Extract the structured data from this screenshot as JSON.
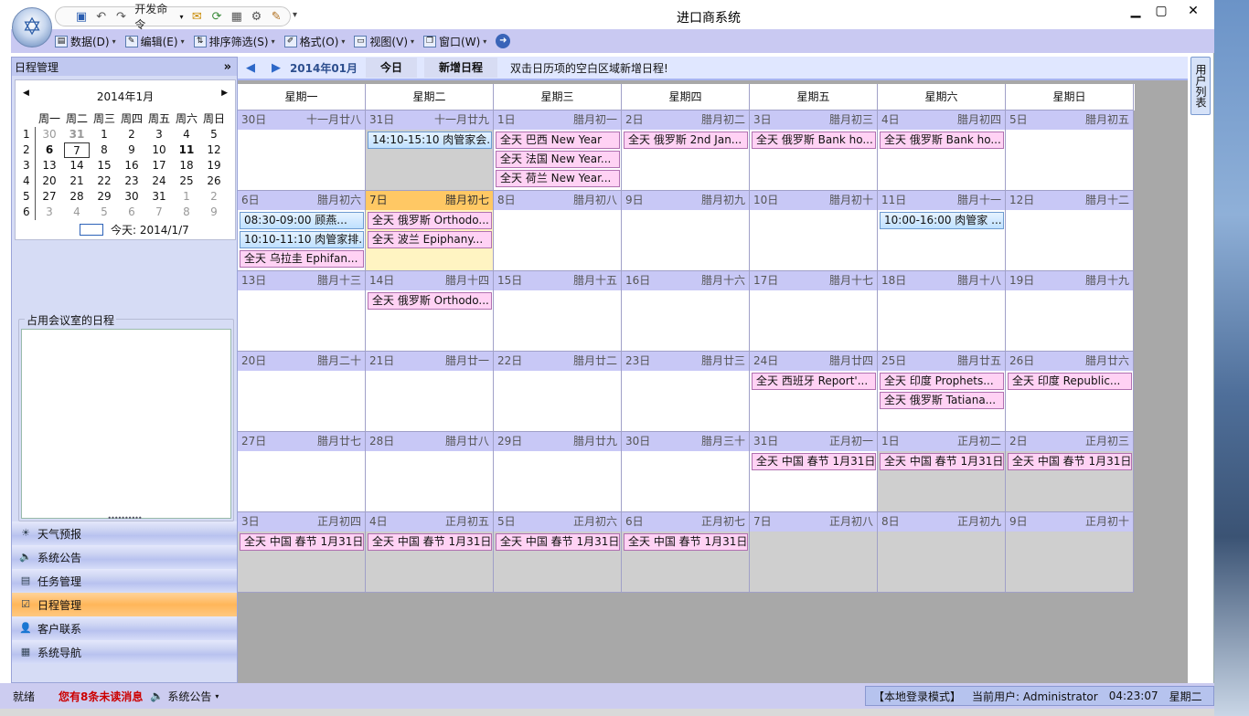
{
  "window": {
    "title": "进口商系统"
  },
  "quick_access": {
    "dev_commands": "开发命令"
  },
  "menu": [
    {
      "label": "数据(D)",
      "icon": "database-icon"
    },
    {
      "label": "编辑(E)",
      "icon": "edit-icon"
    },
    {
      "label": "排序筛选(S)",
      "icon": "sort-filter-icon"
    },
    {
      "label": "格式(O)",
      "icon": "format-brush-icon"
    },
    {
      "label": "视图(V)",
      "icon": "view-icon"
    },
    {
      "label": "窗口(W)",
      "icon": "window-icon"
    }
  ],
  "left_panel": {
    "title": "日程管理",
    "calendar": {
      "title": "2014年1月",
      "weekdays": [
        "周一",
        "周二",
        "周三",
        "周四",
        "周五",
        "周六",
        "周日"
      ],
      "weeks": [
        {
          "wk": "1",
          "days": [
            "30",
            "31",
            "1",
            "2",
            "3",
            "4",
            "5"
          ]
        },
        {
          "wk": "2",
          "days": [
            "6",
            "7",
            "8",
            "9",
            "10",
            "11",
            "12"
          ]
        },
        {
          "wk": "3",
          "days": [
            "13",
            "14",
            "15",
            "16",
            "17",
            "18",
            "19"
          ]
        },
        {
          "wk": "4",
          "days": [
            "20",
            "21",
            "22",
            "23",
            "24",
            "25",
            "26"
          ]
        },
        {
          "wk": "5",
          "days": [
            "27",
            "28",
            "29",
            "30",
            "31",
            "1",
            "2"
          ]
        },
        {
          "wk": "6",
          "days": [
            "3",
            "4",
            "5",
            "6",
            "7",
            "8",
            "9"
          ]
        }
      ],
      "today_label": "今天: 2014/1/7"
    },
    "meeting_group_label": "占用会议室的日程",
    "nav": [
      {
        "label": "天气预报",
        "icon": "weather-icon",
        "active": false
      },
      {
        "label": "系统公告",
        "icon": "speaker-icon",
        "active": false
      },
      {
        "label": "任务管理",
        "icon": "task-icon",
        "active": false
      },
      {
        "label": "日程管理",
        "icon": "schedule-icon",
        "active": true
      },
      {
        "label": "客户联系",
        "icon": "contact-icon",
        "active": false
      },
      {
        "label": "系统导航",
        "icon": "navigation-icon",
        "active": false
      }
    ]
  },
  "toolbar": {
    "month": "2014年01月",
    "today_button": "今日",
    "new_button": "新增日程",
    "hint": "双击日历项的空白区域新增日程!"
  },
  "weekday_headers": [
    "星期一",
    "星期二",
    "星期三",
    "星期四",
    "星期五",
    "星期六",
    "星期日"
  ],
  "weeks": [
    [
      {
        "day": "30日",
        "lunar": "十一月廿八",
        "grey": false,
        "events": []
      },
      {
        "day": "31日",
        "lunar": "十一月廿九",
        "grey": true,
        "events": [
          {
            "text": "14:10-15:10 肉管家会...",
            "timed": true
          }
        ]
      },
      {
        "day": "1日",
        "lunar": "腊月初一",
        "grey": false,
        "events": [
          {
            "text": "全天  巴西 New Year"
          },
          {
            "text": "全天  法国 New Year..."
          },
          {
            "text": "全天  荷兰 New Year..."
          }
        ]
      },
      {
        "day": "2日",
        "lunar": "腊月初二",
        "grey": false,
        "events": [
          {
            "text": "全天  俄罗斯 2nd Jan..."
          }
        ]
      },
      {
        "day": "3日",
        "lunar": "腊月初三",
        "grey": false,
        "events": [
          {
            "text": "全天  俄罗斯 Bank ho..."
          }
        ]
      },
      {
        "day": "4日",
        "lunar": "腊月初四",
        "grey": false,
        "events": [
          {
            "text": "全天  俄罗斯 Bank ho..."
          }
        ]
      },
      {
        "day": "5日",
        "lunar": "腊月初五",
        "grey": false,
        "events": []
      }
    ],
    [
      {
        "day": "6日",
        "lunar": "腊月初六",
        "grey": false,
        "events": [
          {
            "text": "08:30-09:00  顾燕...",
            "timed": true
          },
          {
            "text": "10:10-11:10 肉管家排...",
            "timed": true
          },
          {
            "text": "全天  乌拉圭 Ephifan..."
          }
        ]
      },
      {
        "day": "7日",
        "lunar": "腊月初七",
        "grey": false,
        "today": true,
        "events": [
          {
            "text": "全天  俄罗斯 Orthodo..."
          },
          {
            "text": "全天  波兰 Epiphany..."
          }
        ]
      },
      {
        "day": "8日",
        "lunar": "腊月初八",
        "grey": false,
        "events": []
      },
      {
        "day": "9日",
        "lunar": "腊月初九",
        "grey": false,
        "events": []
      },
      {
        "day": "10日",
        "lunar": "腊月初十",
        "grey": false,
        "events": []
      },
      {
        "day": "11日",
        "lunar": "腊月十一",
        "grey": false,
        "events": [
          {
            "text": "10:00-16:00 肉管家 ...",
            "timed": true
          }
        ]
      },
      {
        "day": "12日",
        "lunar": "腊月十二",
        "grey": false,
        "events": []
      }
    ],
    [
      {
        "day": "13日",
        "lunar": "腊月十三",
        "grey": false,
        "events": []
      },
      {
        "day": "14日",
        "lunar": "腊月十四",
        "grey": false,
        "events": [
          {
            "text": "全天  俄罗斯 Orthodo..."
          }
        ]
      },
      {
        "day": "15日",
        "lunar": "腊月十五",
        "grey": false,
        "events": []
      },
      {
        "day": "16日",
        "lunar": "腊月十六",
        "grey": false,
        "events": []
      },
      {
        "day": "17日",
        "lunar": "腊月十七",
        "grey": false,
        "events": []
      },
      {
        "day": "18日",
        "lunar": "腊月十八",
        "grey": false,
        "events": []
      },
      {
        "day": "19日",
        "lunar": "腊月十九",
        "grey": false,
        "events": []
      }
    ],
    [
      {
        "day": "20日",
        "lunar": "腊月二十",
        "grey": false,
        "events": []
      },
      {
        "day": "21日",
        "lunar": "腊月廿一",
        "grey": false,
        "events": []
      },
      {
        "day": "22日",
        "lunar": "腊月廿二",
        "grey": false,
        "events": []
      },
      {
        "day": "23日",
        "lunar": "腊月廿三",
        "grey": false,
        "events": []
      },
      {
        "day": "24日",
        "lunar": "腊月廿四",
        "grey": false,
        "events": [
          {
            "text": "全天  西班牙 Report'..."
          }
        ]
      },
      {
        "day": "25日",
        "lunar": "腊月廿五",
        "grey": false,
        "events": [
          {
            "text": "全天  印度 Prophets..."
          },
          {
            "text": "全天  俄罗斯 Tatiana..."
          }
        ]
      },
      {
        "day": "26日",
        "lunar": "腊月廿六",
        "grey": false,
        "events": [
          {
            "text": "全天  印度 Republic..."
          }
        ]
      }
    ],
    [
      {
        "day": "27日",
        "lunar": "腊月廿七",
        "grey": false,
        "events": []
      },
      {
        "day": "28日",
        "lunar": "腊月廿八",
        "grey": false,
        "events": []
      },
      {
        "day": "29日",
        "lunar": "腊月廿九",
        "grey": false,
        "events": []
      },
      {
        "day": "30日",
        "lunar": "腊月三十",
        "grey": false,
        "events": []
      },
      {
        "day": "31日",
        "lunar": "正月初一",
        "grey": false,
        "events": [
          {
            "text": "全天  中国 春节 1月31日..."
          }
        ]
      },
      {
        "day": "1日",
        "lunar": "正月初二",
        "grey": true,
        "events": [
          {
            "text": "全天  中国 春节 1月31日..."
          }
        ]
      },
      {
        "day": "2日",
        "lunar": "正月初三",
        "grey": true,
        "events": [
          {
            "text": "全天  中国 春节 1月31日..."
          }
        ]
      }
    ],
    [
      {
        "day": "3日",
        "lunar": "正月初四",
        "grey": true,
        "events": [
          {
            "text": "全天  中国 春节 1月31日..."
          }
        ]
      },
      {
        "day": "4日",
        "lunar": "正月初五",
        "grey": true,
        "events": [
          {
            "text": "全天  中国 春节 1月31日..."
          }
        ]
      },
      {
        "day": "5日",
        "lunar": "正月初六",
        "grey": true,
        "events": [
          {
            "text": "全天  中国 春节 1月31日..."
          }
        ]
      },
      {
        "day": "6日",
        "lunar": "正月初七",
        "grey": true,
        "events": [
          {
            "text": "全天  中国 春节 1月31日..."
          }
        ]
      },
      {
        "day": "7日",
        "lunar": "正月初八",
        "grey": true,
        "events": []
      },
      {
        "day": "8日",
        "lunar": "正月初九",
        "grey": true,
        "events": []
      },
      {
        "day": "9日",
        "lunar": "正月初十",
        "grey": true,
        "events": []
      }
    ]
  ],
  "user_list_tab": "用户列表",
  "status": {
    "ready": "就绪",
    "unread": "您有8条未读消息",
    "notice": "系统公告",
    "login_mode": "【本地登录模式】",
    "current_user": "当前用户: Administrator",
    "time": "04:23:07",
    "weekday": "星期二"
  }
}
